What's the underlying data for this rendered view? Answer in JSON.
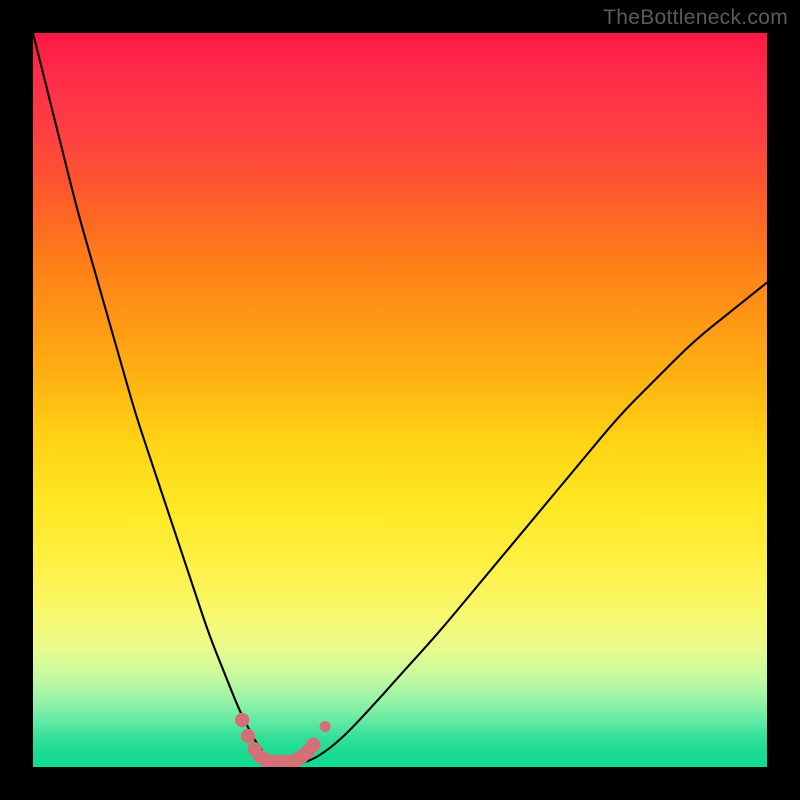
{
  "watermark": "TheBottleneck.com",
  "chart_data": {
    "type": "line",
    "title": "",
    "xlabel": "",
    "ylabel": "",
    "xlim": [
      0,
      100
    ],
    "ylim": [
      0,
      100
    ],
    "grid": false,
    "series": [
      {
        "name": "bottleneck-curve",
        "x": [
          0,
          2,
          4,
          6,
          8,
          10,
          12,
          14,
          16,
          18,
          20,
          22,
          24,
          26,
          28,
          29,
          30,
          31,
          32,
          33,
          34,
          35.5,
          37,
          39,
          42,
          46,
          50,
          55,
          60,
          65,
          70,
          75,
          80,
          85,
          90,
          95,
          100
        ],
        "y": [
          100,
          92,
          84,
          76,
          69,
          62,
          55,
          48,
          42,
          36,
          30,
          24,
          18,
          13,
          8,
          6,
          4,
          2.5,
          1.3,
          0.6,
          0.3,
          0.3,
          0.6,
          1.5,
          3.8,
          8,
          12.5,
          18,
          24,
          30,
          36,
          42,
          48,
          53,
          58,
          62,
          66
        ]
      }
    ],
    "highlighted_points": {
      "name": "marker-cluster",
      "color": "#d37076",
      "points": [
        {
          "x": 28.5,
          "y": 6.4
        },
        {
          "x": 29.3,
          "y": 4.2
        },
        {
          "x": 30.2,
          "y": 2.4
        },
        {
          "x": 31.0,
          "y": 1.4
        },
        {
          "x": 31.8,
          "y": 0.9
        },
        {
          "x": 32.6,
          "y": 0.7
        },
        {
          "x": 33.4,
          "y": 0.7
        },
        {
          "x": 34.2,
          "y": 0.7
        },
        {
          "x": 35.0,
          "y": 0.7
        },
        {
          "x": 35.8,
          "y": 0.9
        },
        {
          "x": 36.6,
          "y": 1.4
        },
        {
          "x": 37.4,
          "y": 2.1
        },
        {
          "x": 38.2,
          "y": 3.0
        },
        {
          "x": 39.8,
          "y": 5.5
        }
      ]
    },
    "background_gradient": {
      "top": "#ff1744",
      "mid_upper": "#ff8c00",
      "mid": "#ffeb3b",
      "mid_lower": "#cddc39",
      "bottom": "#1adc93"
    }
  }
}
